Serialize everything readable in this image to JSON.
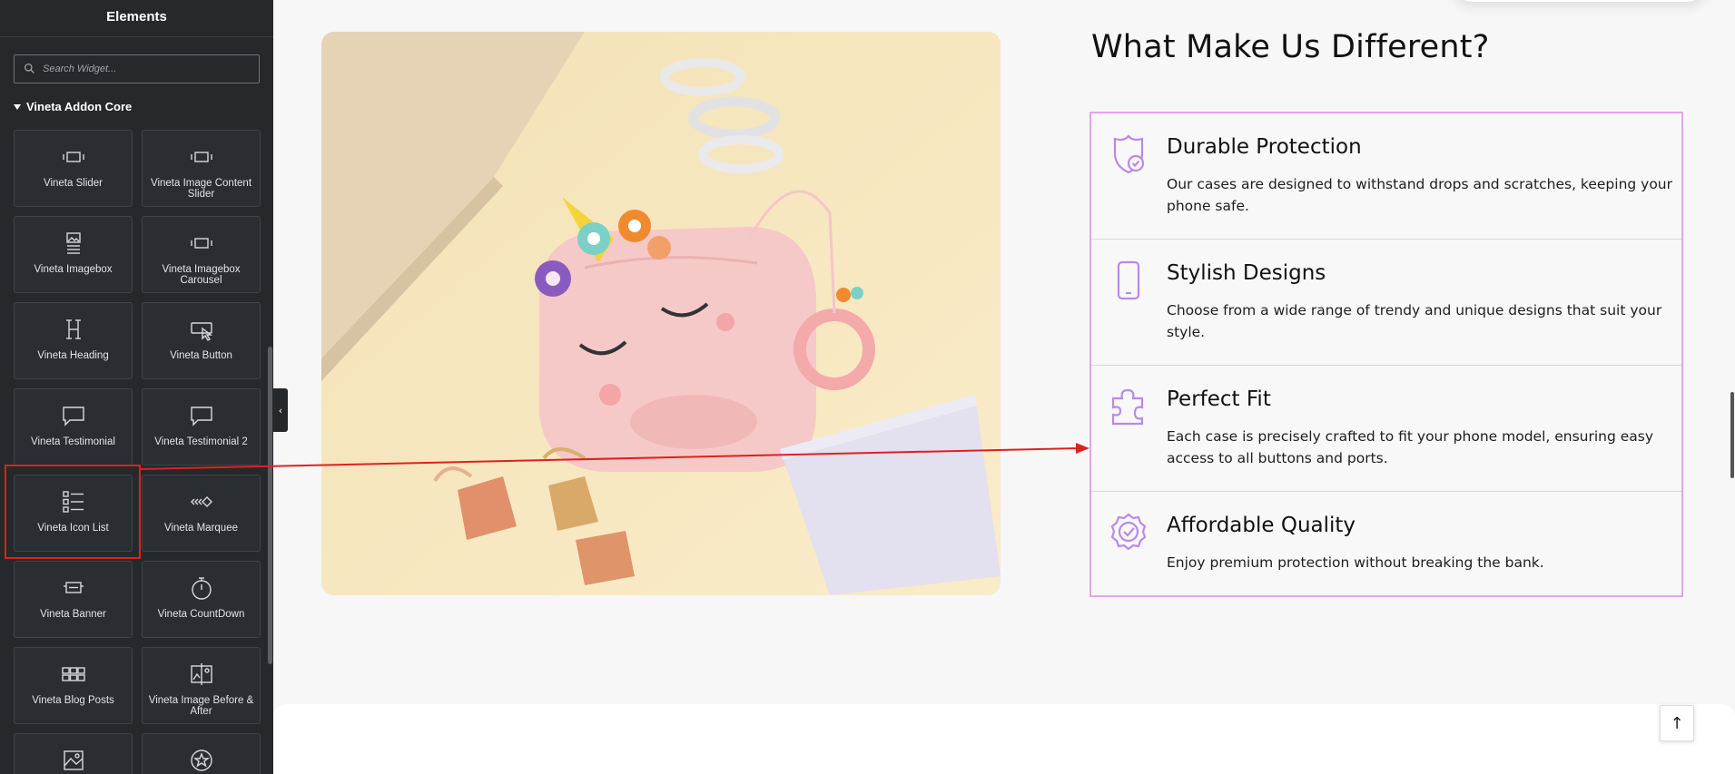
{
  "sidebar": {
    "title": "Elements",
    "search_placeholder": "Search Widget...",
    "category": "Vineta Addon Core",
    "widgets": [
      {
        "label": "Vineta Slider",
        "icon": "slider-icon"
      },
      {
        "label": "Vineta Image Content Slider",
        "icon": "slider-icon"
      },
      {
        "label": "Vineta Imagebox",
        "icon": "imagebox-icon"
      },
      {
        "label": "Vineta Imagebox Carousel",
        "icon": "slider-icon"
      },
      {
        "label": "Vineta Heading",
        "icon": "heading-icon"
      },
      {
        "label": "Vineta Button",
        "icon": "button-icon"
      },
      {
        "label": "Vineta Testimonial",
        "icon": "speech-bubble-icon"
      },
      {
        "label": "Vineta Testimonial 2",
        "icon": "speech-bubble-icon"
      },
      {
        "label": "Vineta Icon List",
        "icon": "icon-list-icon"
      },
      {
        "label": "Vineta Marquee",
        "icon": "marquee-icon"
      },
      {
        "label": "Vineta Banner",
        "icon": "banner-icon"
      },
      {
        "label": "Vineta CountDown",
        "icon": "stopwatch-icon"
      },
      {
        "label": "Vineta Blog Posts",
        "icon": "posts-grid-icon"
      },
      {
        "label": "Vineta Image Before & After",
        "icon": "before-after-icon"
      },
      {
        "label": "",
        "icon": "image-map-icon"
      },
      {
        "label": "",
        "icon": "star-icon"
      }
    ]
  },
  "main": {
    "title": "What Make Us Different?",
    "items": [
      {
        "title": "Durable Protection",
        "desc": "Our cases are designed to withstand drops and scratches, keeping your phone safe.",
        "icon": "shield-check-icon"
      },
      {
        "title": "Stylish Designs",
        "desc": "Choose from a wide range of trendy and unique designs that suit your style.",
        "icon": "phone-icon"
      },
      {
        "title": "Perfect Fit",
        "desc": "Each case is precisely crafted to fit your phone model, ensuring easy access to all buttons and ports.",
        "icon": "puzzle-icon"
      },
      {
        "title": "Affordable Quality",
        "desc": "Enjoy premium protection without breaking the bank.",
        "icon": "badge-check-icon"
      }
    ],
    "back_to_top": "↑"
  },
  "colors": {
    "accent": "#b98ae8",
    "list_border": "#e6a3ef",
    "annotation_red": "#e02020",
    "sidebar_bg": "#26292c"
  }
}
